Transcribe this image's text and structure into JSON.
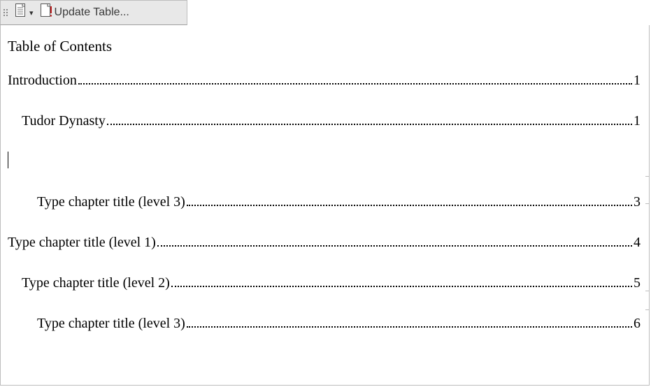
{
  "toolbar": {
    "update_label": "Update Table..."
  },
  "toc": {
    "title": "Table of Contents",
    "entries": [
      {
        "level": 1,
        "text": "Introduction",
        "page": "1"
      },
      {
        "level": 2,
        "text": "Tudor Dynasty",
        "page": "1"
      },
      {
        "blank": true
      },
      {
        "level": 3,
        "text": "Type chapter title (level 3)",
        "page": "3"
      },
      {
        "level": 1,
        "text": "Type chapter title (level 1)",
        "page": "4"
      },
      {
        "level": 2,
        "text": "Type chapter title (level 2)",
        "page": "5"
      },
      {
        "level": 3,
        "text": "Type chapter title (level 3)",
        "page": "6"
      }
    ]
  }
}
